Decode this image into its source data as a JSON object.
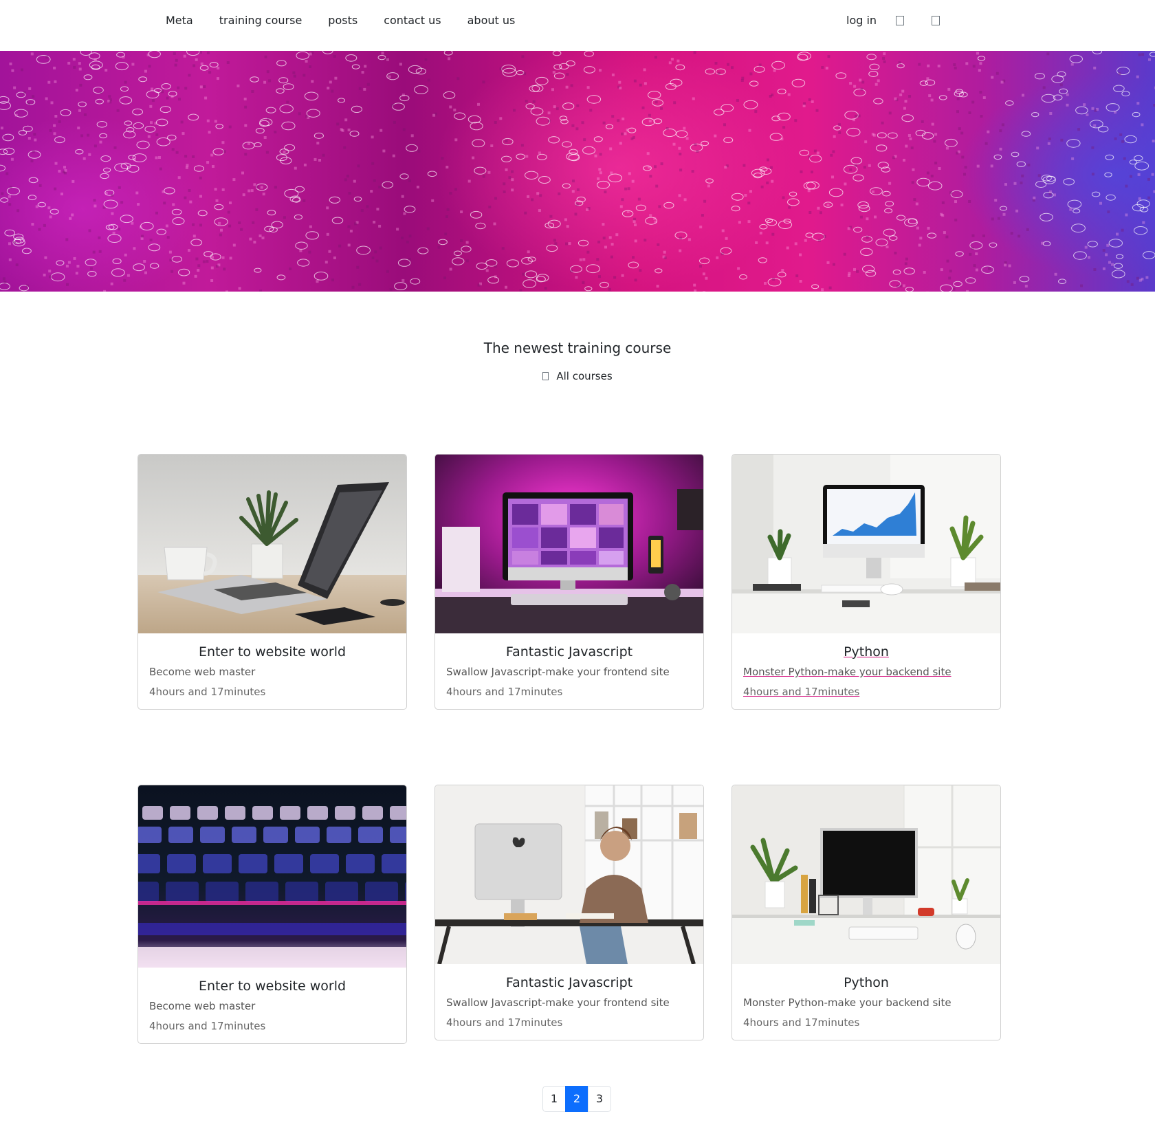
{
  "navbar": {
    "links": [
      "Meta",
      "training course",
      "posts",
      "contact us",
      "about us"
    ],
    "login_label": "log in",
    "right_icons": [
      "user-icon",
      "cart-icon"
    ]
  },
  "hero": {
    "pattern": "pink-purple glitter with bubble rings"
  },
  "section": {
    "title": "The newest training course",
    "all_courses_label": "All courses",
    "all_courses_icon": "grid-icon"
  },
  "cards": [
    {
      "title": "Enter to website world",
      "subtitle": "Become web master",
      "duration": "4hours and 17minutes",
      "image": "laptop-on-desk-with-plant"
    },
    {
      "title": "Fantastic Javascript",
      "subtitle": "Swallow Javascript-make your frontend site",
      "duration": "4hours and 17minutes",
      "image": "imac-with-pink-neon-light"
    },
    {
      "title": "Python",
      "subtitle": "Monster Python-make your backend site",
      "duration": "4hours and 17minutes",
      "image": "imac-on-white-desk-with-plants"
    },
    {
      "title": "Enter to website world",
      "subtitle": "Become web master",
      "duration": "4hours and 17minutes",
      "image": "backlit-keyboard-closeup"
    },
    {
      "title": "Fantastic Javascript",
      "subtitle": "Swallow Javascript-make your frontend site",
      "duration": "4hours and 17minutes",
      "image": "woman-at-imac-desk"
    },
    {
      "title": "Python",
      "subtitle": "Monster Python-make your backend site",
      "duration": "4hours and 17minutes",
      "image": "white-desk-with-monitor-and-plants"
    }
  ],
  "pagination": {
    "pages": [
      "1",
      "2",
      "3"
    ],
    "active_page": "2"
  },
  "colors": {
    "accent_blue": "#0d6efd",
    "hover_underline": "#d4137f",
    "hero_pink": "#d4137f",
    "hero_purple": "#5a3acb"
  }
}
